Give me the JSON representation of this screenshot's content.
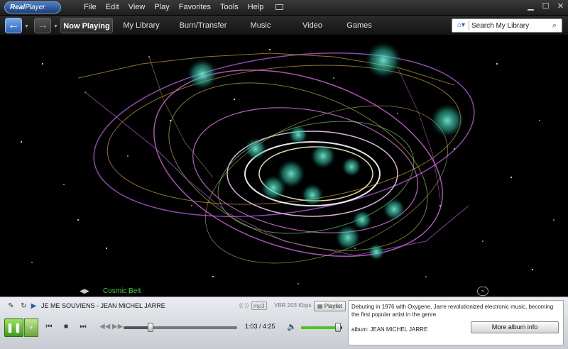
{
  "app": {
    "logo": "Real",
    "logo_suffix": "Player"
  },
  "menu": [
    "File",
    "Edit",
    "View",
    "Play",
    "Favorites",
    "Tools",
    "Help"
  ],
  "tabs": [
    {
      "label": "Now Playing",
      "active": true
    },
    {
      "label": "My Library",
      "active": false
    },
    {
      "label": "Burn/Transfer",
      "active": false
    },
    {
      "label": "Music",
      "active": false
    },
    {
      "label": "Video",
      "active": false
    },
    {
      "label": "Games",
      "active": false
    }
  ],
  "search": {
    "value": "Search My Library"
  },
  "visualization": {
    "name": "Cosmic Belt",
    "name_color": "#3fd13f"
  },
  "track": {
    "title": "JE ME SOUVIENS - JEAN MICHEL JARRE",
    "format": "mp3",
    "bitrate": "VBR 203 Kbps",
    "playlist_label": "Playlist",
    "elapsed": "1:03",
    "duration": "4:25",
    "time_display": "1:03 / 4:25",
    "volume_fraction": 0.9
  },
  "album_info": {
    "blurb": "Debuting in 1976 with Oxygene, Jarre revolutionized electronic music, becoming the first popular artist in the genre.",
    "album": "album: JEAN MICHEL JARRE",
    "more_button": "More album info"
  },
  "colors": {
    "play_green": "#4fc425",
    "nav_blue": "#2b63b8"
  }
}
